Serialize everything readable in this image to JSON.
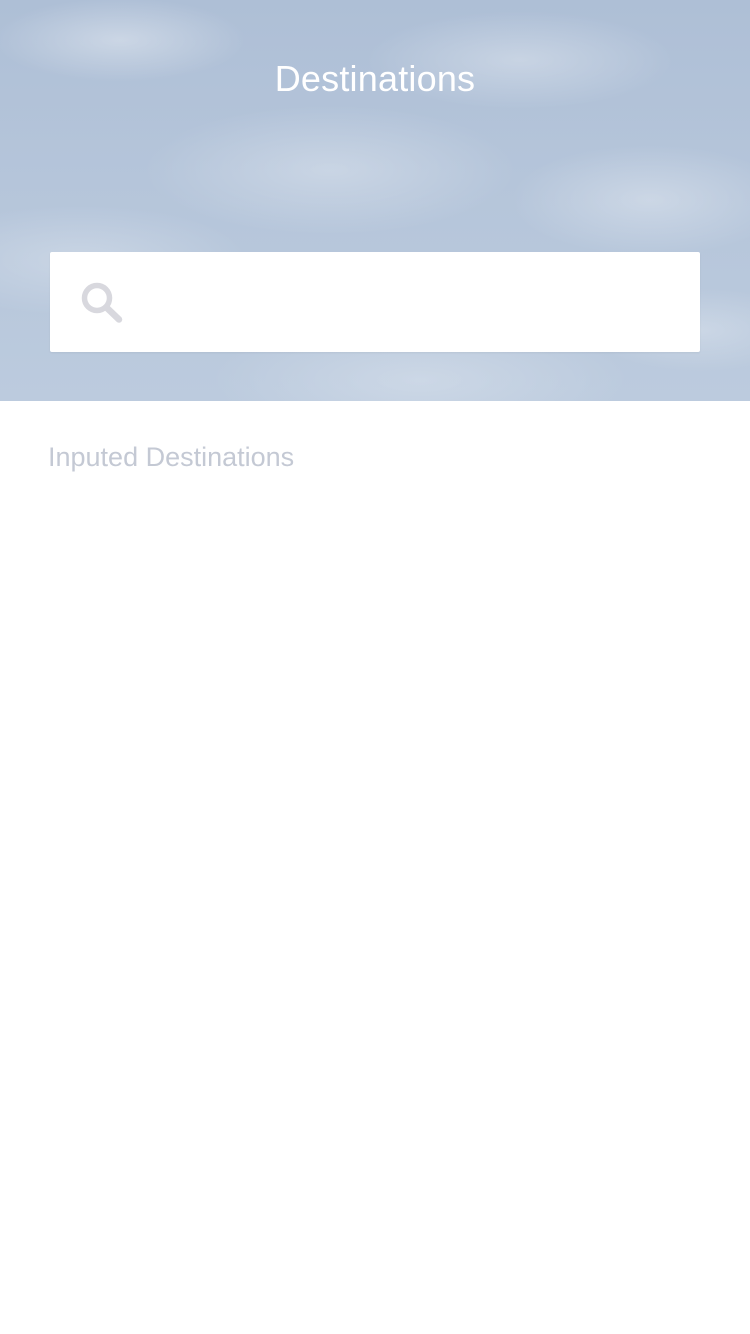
{
  "header": {
    "title": "Destinations"
  },
  "search": {
    "placeholder": "",
    "value": "",
    "icon": "search-icon"
  },
  "section": {
    "label": "Inputed Destinations",
    "items": []
  },
  "colors": {
    "hero_sky": "#b5c5da",
    "title_text": "#ffffff",
    "label_text": "#c4c9d4",
    "icon_gray": "#d8d8de",
    "background": "#ffffff"
  }
}
